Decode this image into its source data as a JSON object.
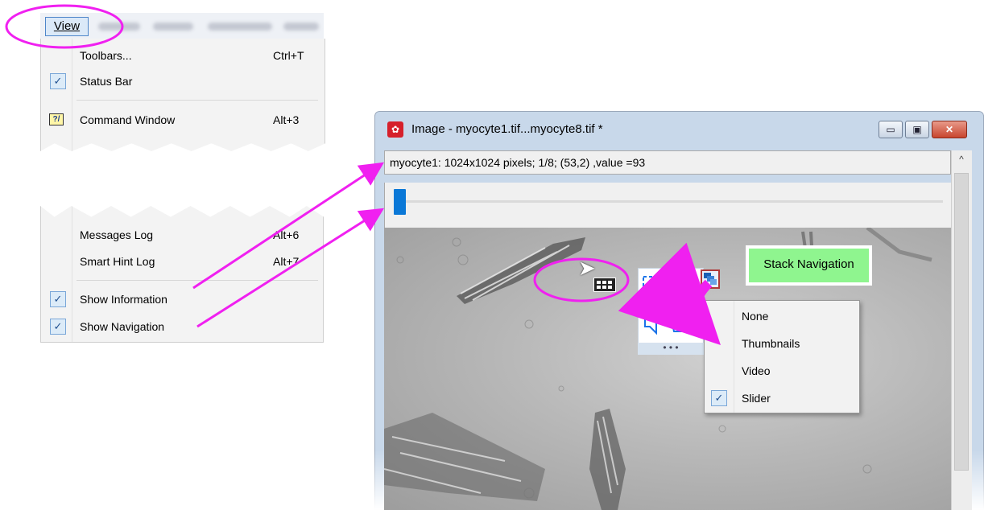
{
  "menu": {
    "title": "View",
    "items": [
      {
        "label": "Toolbars...",
        "shortcut": "Ctrl+T",
        "checked": false
      },
      {
        "label": "Status Bar",
        "shortcut": "",
        "checked": true
      },
      {
        "label": "Command Window",
        "shortcut": "Alt+3",
        "icon": "command-window-icon"
      },
      {
        "label": "Messages Log",
        "shortcut": "Alt+6",
        "checked": false
      },
      {
        "label": "Smart Hint Log",
        "shortcut": "Alt+7",
        "checked": false
      },
      {
        "label": "Show Information",
        "shortcut": "",
        "checked": true
      },
      {
        "label": "Show Navigation",
        "shortcut": "",
        "checked": true
      }
    ],
    "check_glyph": "✓"
  },
  "window": {
    "title": "Image - myocyte1.tif...myocyte8.tif *",
    "info": "myocyte1: 1024x1024 pixels; 1/8; (53,2) ,value =93",
    "controls": {
      "minimize": "▭",
      "restore": "▣",
      "close": "✕"
    },
    "scroll_up": "^",
    "slider": {
      "position": 1,
      "total": 8
    }
  },
  "toolbar": {
    "more": "• • •",
    "stack_navigation_label": "Stack Navigation"
  },
  "popup": {
    "items": [
      {
        "label": "None",
        "checked": false
      },
      {
        "label": "Thumbnails",
        "checked": false
      },
      {
        "label": "Video",
        "checked": false
      },
      {
        "label": "Slider",
        "checked": true
      }
    ]
  },
  "colors": {
    "annotation": "#f020f0",
    "slider_thumb": "#0a78d7",
    "stack_label_bg": "#8ff58f"
  }
}
